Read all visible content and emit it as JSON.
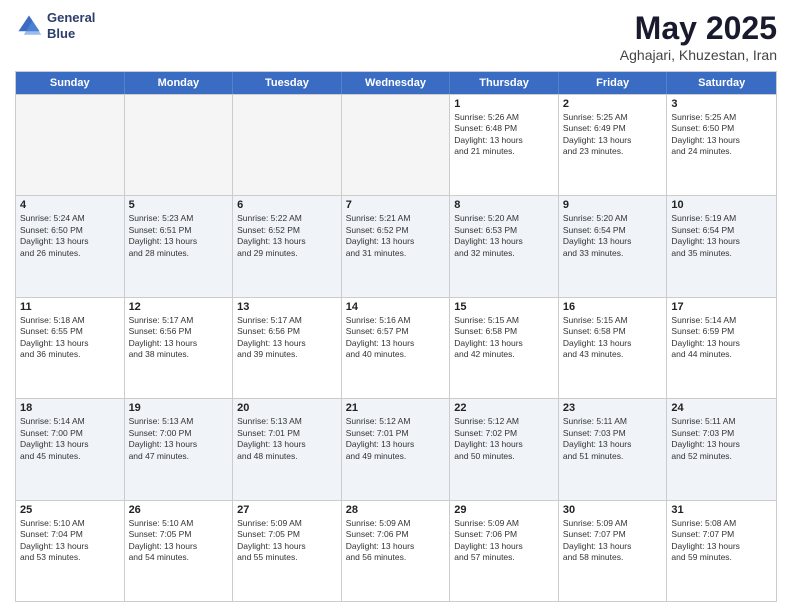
{
  "logo": {
    "line1": "General",
    "line2": "Blue"
  },
  "title": "May 2025",
  "subtitle": "Aghajari, Khuzestan, Iran",
  "header_days": [
    "Sunday",
    "Monday",
    "Tuesday",
    "Wednesday",
    "Thursday",
    "Friday",
    "Saturday"
  ],
  "rows": [
    [
      {
        "day": "",
        "text": ""
      },
      {
        "day": "",
        "text": ""
      },
      {
        "day": "",
        "text": ""
      },
      {
        "day": "",
        "text": ""
      },
      {
        "day": "1",
        "text": "Sunrise: 5:26 AM\nSunset: 6:48 PM\nDaylight: 13 hours\nand 21 minutes."
      },
      {
        "day": "2",
        "text": "Sunrise: 5:25 AM\nSunset: 6:49 PM\nDaylight: 13 hours\nand 23 minutes."
      },
      {
        "day": "3",
        "text": "Sunrise: 5:25 AM\nSunset: 6:50 PM\nDaylight: 13 hours\nand 24 minutes."
      }
    ],
    [
      {
        "day": "4",
        "text": "Sunrise: 5:24 AM\nSunset: 6:50 PM\nDaylight: 13 hours\nand 26 minutes."
      },
      {
        "day": "5",
        "text": "Sunrise: 5:23 AM\nSunset: 6:51 PM\nDaylight: 13 hours\nand 28 minutes."
      },
      {
        "day": "6",
        "text": "Sunrise: 5:22 AM\nSunset: 6:52 PM\nDaylight: 13 hours\nand 29 minutes."
      },
      {
        "day": "7",
        "text": "Sunrise: 5:21 AM\nSunset: 6:52 PM\nDaylight: 13 hours\nand 31 minutes."
      },
      {
        "day": "8",
        "text": "Sunrise: 5:20 AM\nSunset: 6:53 PM\nDaylight: 13 hours\nand 32 minutes."
      },
      {
        "day": "9",
        "text": "Sunrise: 5:20 AM\nSunset: 6:54 PM\nDaylight: 13 hours\nand 33 minutes."
      },
      {
        "day": "10",
        "text": "Sunrise: 5:19 AM\nSunset: 6:54 PM\nDaylight: 13 hours\nand 35 minutes."
      }
    ],
    [
      {
        "day": "11",
        "text": "Sunrise: 5:18 AM\nSunset: 6:55 PM\nDaylight: 13 hours\nand 36 minutes."
      },
      {
        "day": "12",
        "text": "Sunrise: 5:17 AM\nSunset: 6:56 PM\nDaylight: 13 hours\nand 38 minutes."
      },
      {
        "day": "13",
        "text": "Sunrise: 5:17 AM\nSunset: 6:56 PM\nDaylight: 13 hours\nand 39 minutes."
      },
      {
        "day": "14",
        "text": "Sunrise: 5:16 AM\nSunset: 6:57 PM\nDaylight: 13 hours\nand 40 minutes."
      },
      {
        "day": "15",
        "text": "Sunrise: 5:15 AM\nSunset: 6:58 PM\nDaylight: 13 hours\nand 42 minutes."
      },
      {
        "day": "16",
        "text": "Sunrise: 5:15 AM\nSunset: 6:58 PM\nDaylight: 13 hours\nand 43 minutes."
      },
      {
        "day": "17",
        "text": "Sunrise: 5:14 AM\nSunset: 6:59 PM\nDaylight: 13 hours\nand 44 minutes."
      }
    ],
    [
      {
        "day": "18",
        "text": "Sunrise: 5:14 AM\nSunset: 7:00 PM\nDaylight: 13 hours\nand 45 minutes."
      },
      {
        "day": "19",
        "text": "Sunrise: 5:13 AM\nSunset: 7:00 PM\nDaylight: 13 hours\nand 47 minutes."
      },
      {
        "day": "20",
        "text": "Sunrise: 5:13 AM\nSunset: 7:01 PM\nDaylight: 13 hours\nand 48 minutes."
      },
      {
        "day": "21",
        "text": "Sunrise: 5:12 AM\nSunset: 7:01 PM\nDaylight: 13 hours\nand 49 minutes."
      },
      {
        "day": "22",
        "text": "Sunrise: 5:12 AM\nSunset: 7:02 PM\nDaylight: 13 hours\nand 50 minutes."
      },
      {
        "day": "23",
        "text": "Sunrise: 5:11 AM\nSunset: 7:03 PM\nDaylight: 13 hours\nand 51 minutes."
      },
      {
        "day": "24",
        "text": "Sunrise: 5:11 AM\nSunset: 7:03 PM\nDaylight: 13 hours\nand 52 minutes."
      }
    ],
    [
      {
        "day": "25",
        "text": "Sunrise: 5:10 AM\nSunset: 7:04 PM\nDaylight: 13 hours\nand 53 minutes."
      },
      {
        "day": "26",
        "text": "Sunrise: 5:10 AM\nSunset: 7:05 PM\nDaylight: 13 hours\nand 54 minutes."
      },
      {
        "day": "27",
        "text": "Sunrise: 5:09 AM\nSunset: 7:05 PM\nDaylight: 13 hours\nand 55 minutes."
      },
      {
        "day": "28",
        "text": "Sunrise: 5:09 AM\nSunset: 7:06 PM\nDaylight: 13 hours\nand 56 minutes."
      },
      {
        "day": "29",
        "text": "Sunrise: 5:09 AM\nSunset: 7:06 PM\nDaylight: 13 hours\nand 57 minutes."
      },
      {
        "day": "30",
        "text": "Sunrise: 5:09 AM\nSunset: 7:07 PM\nDaylight: 13 hours\nand 58 minutes."
      },
      {
        "day": "31",
        "text": "Sunrise: 5:08 AM\nSunset: 7:07 PM\nDaylight: 13 hours\nand 59 minutes."
      }
    ]
  ]
}
